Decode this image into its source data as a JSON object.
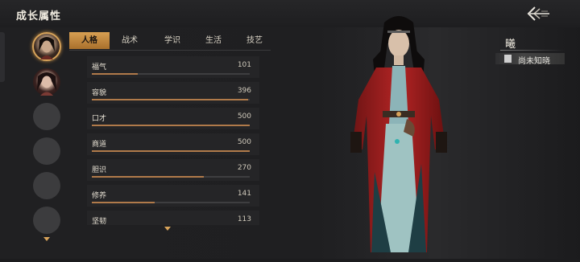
{
  "header": {
    "title": "成长属性"
  },
  "tabs": [
    {
      "label": "人格",
      "active": true
    },
    {
      "label": "战术",
      "active": false
    },
    {
      "label": "学识",
      "active": false
    },
    {
      "label": "生活",
      "active": false
    },
    {
      "label": "技艺",
      "active": false
    }
  ],
  "attributes": [
    {
      "name": "福气",
      "value": "101",
      "fraction": 0.29
    },
    {
      "name": "容貌",
      "value": "396",
      "fraction": 0.99
    },
    {
      "name": "口才",
      "value": "500",
      "fraction": 1.0
    },
    {
      "name": "商道",
      "value": "500",
      "fraction": 1.0
    },
    {
      "name": "胆识",
      "value": "270",
      "fraction": 0.71
    },
    {
      "name": "修养",
      "value": "141",
      "fraction": 0.4
    },
    {
      "name": "坚韧",
      "value": "113",
      "fraction": 0.3
    }
  ],
  "character": {
    "name": "曦",
    "title": "尚未知晓"
  },
  "colors": {
    "accent": "#d79f52",
    "bar_fill": "#b07a4a",
    "background": "#1c1c1e"
  }
}
